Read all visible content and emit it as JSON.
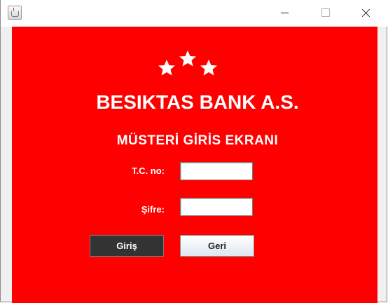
{
  "window": {
    "title": "",
    "controls": {
      "minimize_icon": "minimize-icon",
      "maximize_icon": "maximize-icon",
      "close_icon": "close-icon"
    }
  },
  "brand": {
    "logo_icon": "three-stars-icon",
    "title": "BESIKTAS BANK A.S.",
    "subtitle": "MÜSTERİ GİRİS EKRANI",
    "background_color": "#ff0000",
    "text_color": "#ffffff"
  },
  "form": {
    "tc_label": "T.C. no:",
    "tc_value": "",
    "password_label": "Şifre:",
    "password_value": ""
  },
  "buttons": {
    "login_label": "Giriş",
    "back_label": "Geri"
  }
}
